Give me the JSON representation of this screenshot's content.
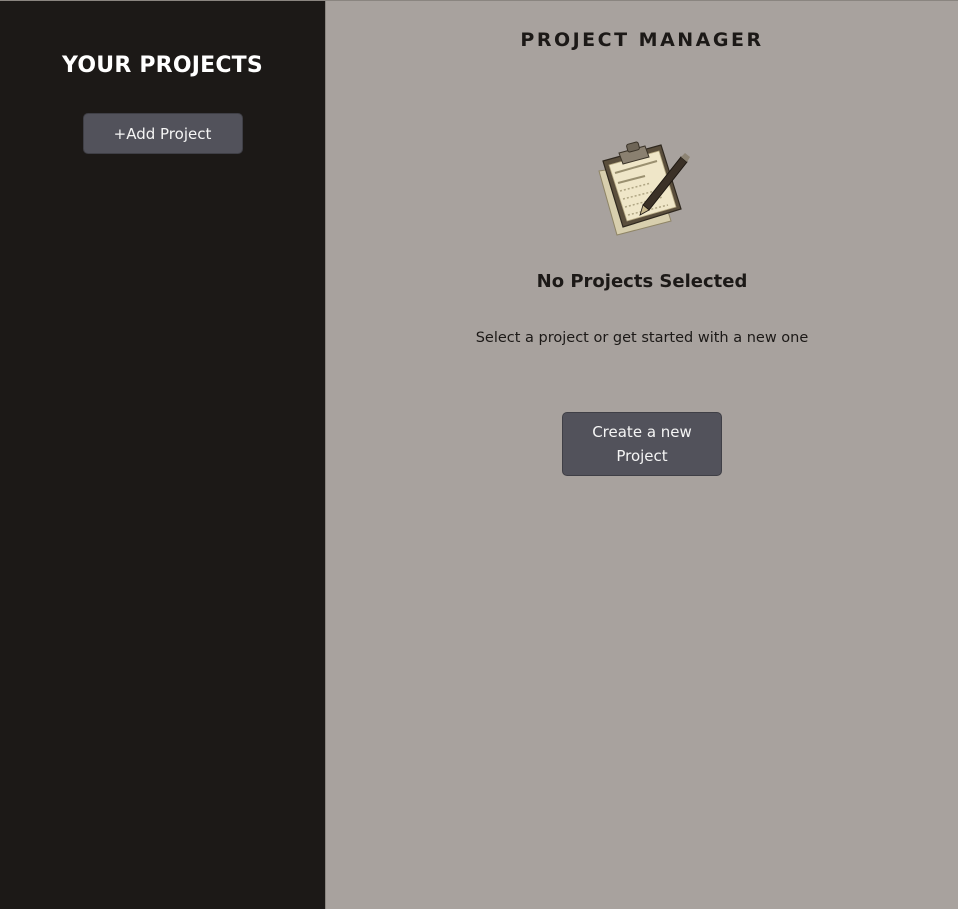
{
  "sidebar": {
    "title": "YOUR PROJECTS",
    "add_button_label": "+Add Project"
  },
  "main": {
    "app_title": "PROJECT MANAGER",
    "empty_state": {
      "icon": "clipboard-with-pen-icon",
      "heading": "No Projects Selected",
      "description": "Select a project or get started with a new one",
      "create_button_label": "Create a new Project"
    }
  },
  "colors": {
    "sidebar_bg": "#1c1917",
    "main_bg": "#a8a29e",
    "button_bg": "#52525b",
    "button_text": "#f5f5f5"
  }
}
